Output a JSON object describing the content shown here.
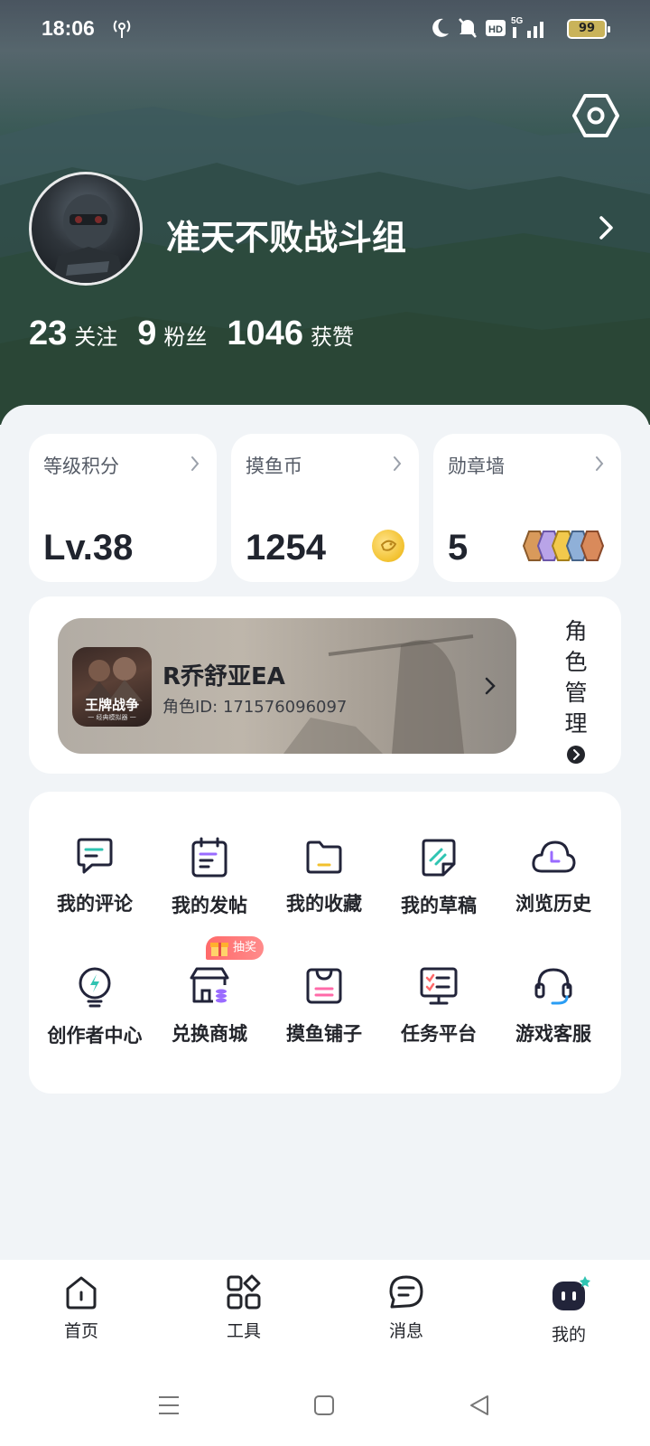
{
  "status_bar": {
    "time": "18:06",
    "battery": "99",
    "icons": [
      "nfc-signal-icon",
      "moon-icon",
      "mute-bell-icon",
      "hd-icon",
      "5g-signal-icon",
      "battery-icon"
    ]
  },
  "profile": {
    "username": "准天不败战斗组",
    "stats": [
      {
        "value": "23",
        "label": "关注"
      },
      {
        "value": "9",
        "label": "粉丝"
      },
      {
        "value": "1046",
        "label": "获赞"
      }
    ]
  },
  "summary_cards": [
    {
      "title": "等级积分",
      "value": "Lv.38"
    },
    {
      "title": "摸鱼币",
      "value": "1254"
    },
    {
      "title": "勋章墙",
      "value": "5"
    }
  ],
  "role_card": {
    "game_title": "王牌战争",
    "game_subtitle": "一 经典模拟器 一",
    "role_name": "R乔舒亚EA",
    "role_id": "角色ID: 171576096097",
    "manage_label": [
      "角",
      "色",
      "管",
      "理"
    ]
  },
  "menu": {
    "items": [
      {
        "label": "我的评论",
        "icon": "comment-icon"
      },
      {
        "label": "我的发帖",
        "icon": "post-icon"
      },
      {
        "label": "我的收藏",
        "icon": "folder-icon"
      },
      {
        "label": "我的草稿",
        "icon": "draft-icon"
      },
      {
        "label": "浏览历史",
        "icon": "history-icon"
      },
      {
        "label": "创作者中心",
        "icon": "creator-bulb-icon"
      },
      {
        "label": "兑换商城",
        "icon": "shop-icon"
      },
      {
        "label": "摸鱼铺子",
        "icon": "bag-icon"
      },
      {
        "label": "任务平台",
        "icon": "task-icon"
      },
      {
        "label": "游戏客服",
        "icon": "headset-icon"
      }
    ],
    "lottery_badge": "抽奖"
  },
  "tabbar": {
    "tabs": [
      {
        "label": "首页",
        "icon": "home-icon"
      },
      {
        "label": "工具",
        "icon": "tools-icon"
      },
      {
        "label": "消息",
        "icon": "message-icon"
      },
      {
        "label": "我的",
        "icon": "me-icon",
        "active": true
      }
    ]
  },
  "colors": {
    "accent_cyan": "#2fc4b2",
    "accent_purple": "#9a6bff",
    "accent_red": "#ff6a6a",
    "dark": "#22243a"
  }
}
